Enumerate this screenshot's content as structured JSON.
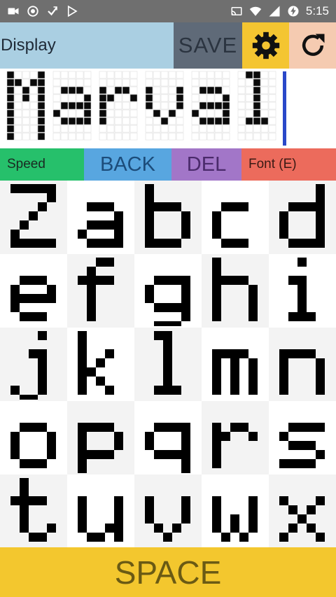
{
  "status_bar": {
    "time": "5:15",
    "left_icons": [
      "video-icon",
      "record-icon",
      "download-icon",
      "play-store-icon"
    ],
    "right_icons": [
      "cast-icon",
      "wifi-icon",
      "signal-icon",
      "battery-charging-icon"
    ]
  },
  "toolbar": {
    "display_label": "Display",
    "save_label": "SAVE",
    "settings_icon": "gear-icon",
    "refresh_icon": "refresh-icon"
  },
  "display": {
    "text": "Marval"
  },
  "controls": {
    "speed_label": "Speed",
    "back_label": "BACK",
    "del_label": "DEL",
    "font_label": "Font (E)"
  },
  "keyboard": {
    "keys": [
      "Z",
      "a",
      "b",
      "c",
      "d",
      "e",
      "f",
      "g",
      "h",
      "i",
      "j",
      "k",
      "l",
      "m",
      "n",
      "o",
      "p",
      "q",
      "r",
      "s",
      "t",
      "u",
      "v",
      "w",
      "x"
    ]
  },
  "space_label": "SPACE",
  "colors": {
    "status_bar": "#6f6f6f",
    "display_bg": "#aacfe2",
    "save_bg": "#5f6a78",
    "gear_bg": "#f4c531",
    "refresh_bg": "#f5cbb1",
    "speed_bg": "#26c06b",
    "back_bg": "#58a6e0",
    "del_bg": "#a276c8",
    "font_bg": "#ec6b5c",
    "space_bg": "#f3c72e",
    "cursor": "#2a48c9"
  }
}
